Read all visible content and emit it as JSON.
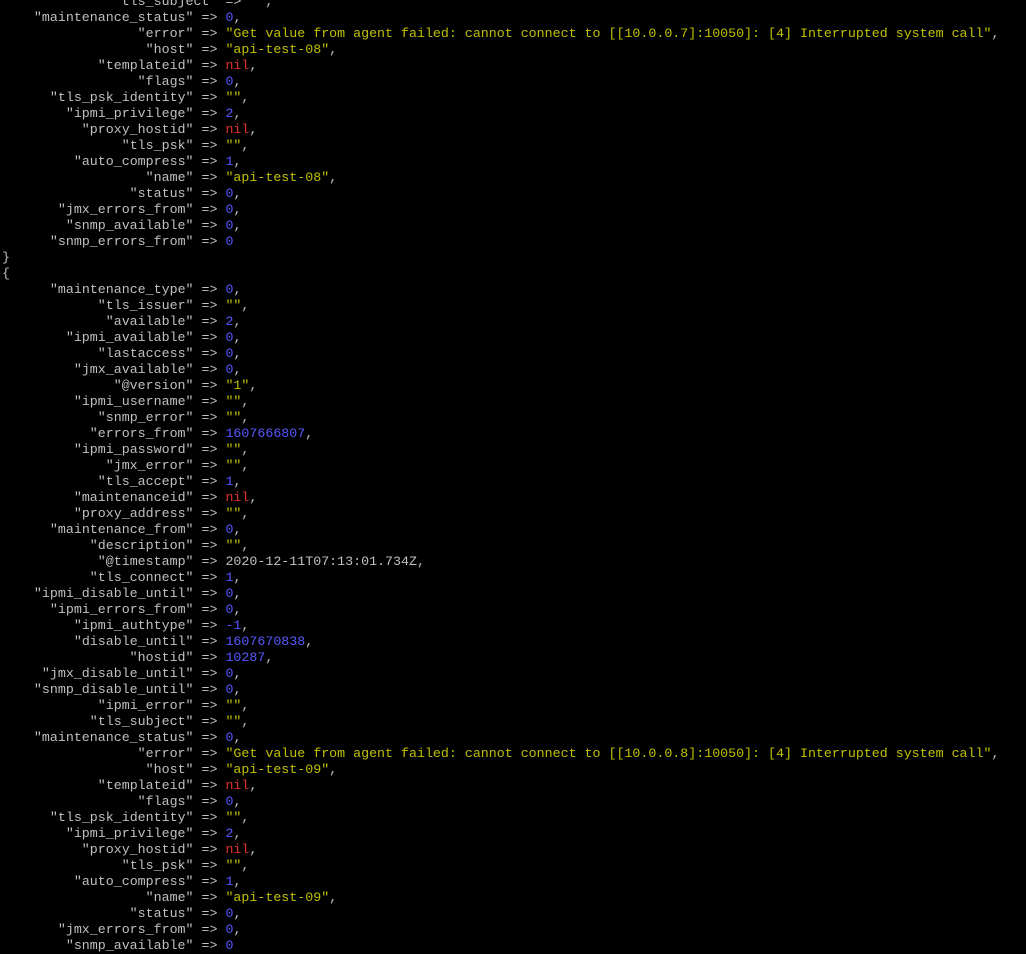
{
  "colors": {
    "background": "#000000",
    "key": "#c0c0c0",
    "string": "#c0c000",
    "number": "#5858ff",
    "nil": "#e03030"
  },
  "terminal": {
    "lines": [
      {
        "k": "tls_subject",
        "t": "str",
        "v": "\"\"",
        "i": 14
      },
      {
        "k": "maintenance_status",
        "t": "num",
        "v": "0",
        "i": 4
      },
      {
        "k": "error",
        "t": "str",
        "v": "\"Get value from agent failed: cannot connect to [[10.0.0.7]:10050]: [4] Interrupted system call\"",
        "i": 17
      },
      {
        "k": "host",
        "t": "str",
        "v": "\"api-test-08\"",
        "i": 18
      },
      {
        "k": "templateid",
        "t": "nil",
        "v": "nil",
        "i": 12
      },
      {
        "k": "flags",
        "t": "num",
        "v": "0",
        "i": 17
      },
      {
        "k": "tls_psk_identity",
        "t": "str",
        "v": "\"\"",
        "i": 6
      },
      {
        "k": "ipmi_privilege",
        "t": "num",
        "v": "2",
        "i": 8
      },
      {
        "k": "proxy_hostid",
        "t": "nil",
        "v": "nil",
        "i": 10
      },
      {
        "k": "tls_psk",
        "t": "str",
        "v": "\"\"",
        "i": 15
      },
      {
        "k": "auto_compress",
        "t": "num",
        "v": "1",
        "i": 9
      },
      {
        "k": "name",
        "t": "str",
        "v": "\"api-test-08\"",
        "i": 18
      },
      {
        "k": "status",
        "t": "num",
        "v": "0",
        "i": 16
      },
      {
        "k": "jmx_errors_from",
        "t": "num",
        "v": "0",
        "i": 7
      },
      {
        "k": "snmp_available",
        "t": "num",
        "v": "0",
        "i": 8
      },
      {
        "k": "snmp_errors_from",
        "t": "num",
        "v": "0",
        "i": 6,
        "last": true
      },
      {
        "raw": "}"
      },
      {
        "raw": "{"
      },
      {
        "k": "maintenance_type",
        "t": "num",
        "v": "0",
        "i": 6
      },
      {
        "k": "tls_issuer",
        "t": "str",
        "v": "\"\"",
        "i": 12
      },
      {
        "k": "available",
        "t": "num",
        "v": "2",
        "i": 13
      },
      {
        "k": "ipmi_available",
        "t": "num",
        "v": "0",
        "i": 8
      },
      {
        "k": "lastaccess",
        "t": "num",
        "v": "0",
        "i": 12
      },
      {
        "k": "jmx_available",
        "t": "num",
        "v": "0",
        "i": 9
      },
      {
        "k": "@version",
        "t": "str",
        "v": "\"1\"",
        "i": 14
      },
      {
        "k": "ipmi_username",
        "t": "str",
        "v": "\"\"",
        "i": 9
      },
      {
        "k": "snmp_error",
        "t": "str",
        "v": "\"\"",
        "i": 12
      },
      {
        "k": "errors_from",
        "t": "num",
        "v": "1607666807",
        "i": 11
      },
      {
        "k": "ipmi_password",
        "t": "str",
        "v": "\"\"",
        "i": 9
      },
      {
        "k": "jmx_error",
        "t": "str",
        "v": "\"\"",
        "i": 13
      },
      {
        "k": "tls_accept",
        "t": "num",
        "v": "1",
        "i": 12
      },
      {
        "k": "maintenanceid",
        "t": "nil",
        "v": "nil",
        "i": 9
      },
      {
        "k": "proxy_address",
        "t": "str",
        "v": "\"\"",
        "i": 9
      },
      {
        "k": "maintenance_from",
        "t": "num",
        "v": "0",
        "i": 6
      },
      {
        "k": "description",
        "t": "str",
        "v": "\"\"",
        "i": 11
      },
      {
        "k": "@timestamp",
        "t": "plain",
        "v": "2020-12-11T07:13:01.734Z",
        "i": 12
      },
      {
        "k": "tls_connect",
        "t": "num",
        "v": "1",
        "i": 11
      },
      {
        "k": "ipmi_disable_until",
        "t": "num",
        "v": "0",
        "i": 4
      },
      {
        "k": "ipmi_errors_from",
        "t": "num",
        "v": "0",
        "i": 6
      },
      {
        "k": "ipmi_authtype",
        "t": "num",
        "v": "-1",
        "i": 9
      },
      {
        "k": "disable_until",
        "t": "num",
        "v": "1607670838",
        "i": 9
      },
      {
        "k": "hostid",
        "t": "num",
        "v": "10287",
        "i": 16
      },
      {
        "k": "jmx_disable_until",
        "t": "num",
        "v": "0",
        "i": 5
      },
      {
        "k": "snmp_disable_until",
        "t": "num",
        "v": "0",
        "i": 4
      },
      {
        "k": "ipmi_error",
        "t": "str",
        "v": "\"\"",
        "i": 12
      },
      {
        "k": "tls_subject",
        "t": "str",
        "v": "\"\"",
        "i": 11
      },
      {
        "k": "maintenance_status",
        "t": "num",
        "v": "0",
        "i": 4
      },
      {
        "k": "error",
        "t": "str",
        "v": "\"Get value from agent failed: cannot connect to [[10.0.0.8]:10050]: [4] Interrupted system call\"",
        "i": 17
      },
      {
        "k": "host",
        "t": "str",
        "v": "\"api-test-09\"",
        "i": 18
      },
      {
        "k": "templateid",
        "t": "nil",
        "v": "nil",
        "i": 12
      },
      {
        "k": "flags",
        "t": "num",
        "v": "0",
        "i": 17
      },
      {
        "k": "tls_psk_identity",
        "t": "str",
        "v": "\"\"",
        "i": 6
      },
      {
        "k": "ipmi_privilege",
        "t": "num",
        "v": "2",
        "i": 8
      },
      {
        "k": "proxy_hostid",
        "t": "nil",
        "v": "nil",
        "i": 10
      },
      {
        "k": "tls_psk",
        "t": "str",
        "v": "\"\"",
        "i": 15
      },
      {
        "k": "auto_compress",
        "t": "num",
        "v": "1",
        "i": 9
      },
      {
        "k": "name",
        "t": "str",
        "v": "\"api-test-09\"",
        "i": 18
      },
      {
        "k": "status",
        "t": "num",
        "v": "0",
        "i": 16
      },
      {
        "k": "jmx_errors_from",
        "t": "num",
        "v": "0",
        "i": 7
      },
      {
        "k": "snmp_available",
        "t": "num",
        "v": "0",
        "i": 8,
        "last": true
      }
    ]
  }
}
